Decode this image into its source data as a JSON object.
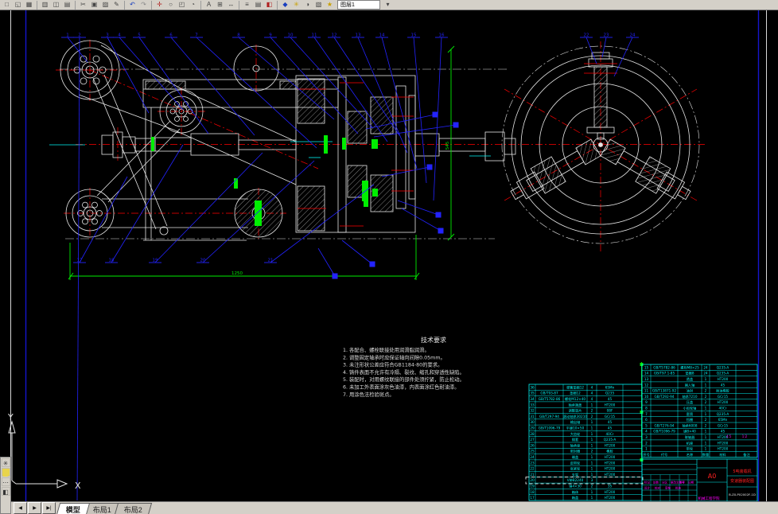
{
  "colors": {
    "canvas_bg": "#000000",
    "line_white": "#e6e6e6",
    "centerline_red": "#ff0000",
    "leader_blue": "#2323ff",
    "dim_green": "#00ee00",
    "table_cyan": "#00f5f5",
    "magenta": "#ff00ff",
    "chrome": "#d4d0c8"
  },
  "toolbar": {
    "icons": [
      {
        "name": "new-icon",
        "glyph": "□"
      },
      {
        "name": "open-icon",
        "glyph": "◱"
      },
      {
        "name": "save-icon",
        "glyph": "▦"
      },
      {
        "sep": true
      },
      {
        "name": "plot-icon",
        "glyph": "▥"
      },
      {
        "name": "plot-preview-icon",
        "glyph": "◫"
      },
      {
        "name": "publish-icon",
        "glyph": "▤"
      },
      {
        "sep": true
      },
      {
        "name": "cut-icon",
        "glyph": "✂"
      },
      {
        "name": "copy-icon",
        "glyph": "▣"
      },
      {
        "name": "paste-icon",
        "glyph": "▨"
      },
      {
        "name": "match-properties-icon",
        "glyph": "✎"
      },
      {
        "sep": true
      },
      {
        "name": "undo-icon",
        "glyph": "↶",
        "color": "#1a3fbf"
      },
      {
        "name": "redo-icon",
        "glyph": "↷",
        "color": "#8a8a8a"
      },
      {
        "sep": true
      },
      {
        "name": "pan-icon",
        "glyph": "✛",
        "color": "#b02020"
      },
      {
        "name": "zoom-realtime-icon",
        "glyph": "○"
      },
      {
        "name": "zoom-window-icon",
        "glyph": "◰"
      },
      {
        "name": "zoom-previous-icon",
        "glyph": "◔"
      },
      {
        "sep": true
      },
      {
        "name": "text-icon",
        "glyph": "A"
      },
      {
        "name": "table-icon",
        "glyph": "⊞"
      },
      {
        "name": "dimension-icon",
        "glyph": "↔"
      },
      {
        "sep": true
      },
      {
        "name": "layers-icon",
        "glyph": "≡"
      },
      {
        "name": "layer-states-icon",
        "glyph": "▤"
      },
      {
        "name": "properties-icon",
        "glyph": "◧",
        "color": "#b02020"
      },
      {
        "sep": true
      },
      {
        "name": "3d-views-icon",
        "glyph": "◆",
        "color": "#1a3fbf"
      },
      {
        "name": "light-icon",
        "glyph": "✳",
        "color": "#c8a000"
      },
      {
        "name": "render-icon",
        "glyph": "◑"
      },
      {
        "name": "sheet-set-icon",
        "glyph": "▧"
      },
      {
        "name": "star-icon",
        "glyph": "★",
        "color": "#c8a000"
      }
    ],
    "layer_combo": "图层1",
    "trailing_icons": [
      {
        "name": "layer-dropdown-arrow-icon",
        "glyph": "▾"
      }
    ]
  },
  "dock_icons": [
    {
      "name": "brightness-icon",
      "glyph": "✳"
    },
    {
      "name": "gradient-swatch-icon",
      "glyph": "▆",
      "color": "#e8d44c"
    },
    {
      "name": "more-dots-icon",
      "glyph": "⋯"
    },
    {
      "name": "half-shade-icon",
      "glyph": "◧"
    }
  ],
  "tabbar": {
    "nav": [
      "◀",
      "▶",
      "▶|"
    ],
    "tabs": [
      {
        "label": "模型",
        "active": true
      },
      {
        "label": "布局1",
        "active": false
      },
      {
        "label": "布局2",
        "active": false
      }
    ]
  },
  "ucs": {
    "x_label": "X",
    "y_label": "Y"
  },
  "tech_requirements": {
    "title": "技术要求",
    "lines": [
      "1. 各配合、螺栓联接处用润滑脂润滑。",
      "2. 调整固定轴承时应保证轴向间隙0.05mm。",
      "3. 未注形状公差应符合GB1184-80的要求。",
      "4. 铸件表面不允许有冷隔、裂纹、缩孔和穿透性缺陷。",
      "5. 装配时，对用螺纹联接的部件处须拧紧，防止松动。",
      "6. 未加工外表面涂灰色油漆，内表面涂红色耐油漆。",
      "7. 用涂色法检验斑点。"
    ]
  },
  "balloons": {
    "top": [
      "1",
      "2",
      "3",
      "4",
      "5",
      "6",
      "7",
      "8",
      "9",
      "10",
      "11",
      "12",
      "13",
      "14",
      "15",
      "16"
    ],
    "bottom": [
      "17",
      "18",
      "19",
      "20",
      "21"
    ],
    "right_view": [
      "22",
      "23",
      "24"
    ]
  },
  "dimensions": {
    "overall_width": "1250",
    "overall_height": "545"
  },
  "bom": {
    "header": [
      "序号",
      "代号",
      "名称",
      "数量",
      "材料",
      "备注"
    ],
    "left_rows": [
      [
        "36",
        "",
        "弹簧垫圈12",
        "4",
        "65Mn"
      ],
      [
        "35",
        "GB/T93-87",
        "垫圈12",
        "4",
        "Q235"
      ],
      [
        "34",
        "GB/T5782-86",
        "螺栓M12×40",
        "4",
        "45"
      ],
      [
        "33",
        "",
        "轴承端盖",
        "1",
        "HT200"
      ],
      [
        "32",
        "",
        "调整垫片",
        "2",
        "08F"
      ],
      [
        "31",
        "GB/T297-94",
        "滚动轴承30210",
        "2",
        "GCr15"
      ],
      [
        "30",
        "",
        "输出轴",
        "1",
        "45"
      ],
      [
        "29",
        "GB/T1096-79",
        "平键10×50",
        "1",
        "45"
      ],
      [
        "28",
        "",
        "大齿轮",
        "1",
        "40Cr"
      ],
      [
        "27",
        "",
        "隔套",
        "1",
        "Q235-A"
      ],
      [
        "26",
        "",
        "轴承座",
        "1",
        "HT200"
      ],
      [
        "25",
        "",
        "密封圈",
        "2",
        "橡胶"
      ],
      [
        "24",
        "",
        "端盖",
        "1",
        "HT200"
      ],
      [
        "23",
        "",
        "皮带轮",
        "1",
        "HT200"
      ],
      [
        "22",
        "",
        "张紧轮",
        "1",
        "HT200"
      ],
      [
        "21",
        "",
        "支架",
        "1",
        "HT200"
      ],
      [
        "20",
        "",
        "V带B2240",
        "3",
        ""
      ],
      [
        "19",
        "",
        "销4×30",
        "2",
        "35"
      ],
      [
        "18",
        "",
        "箱体",
        "1",
        "HT200"
      ],
      [
        "17",
        "",
        "箱盖",
        "1",
        "HT200"
      ]
    ],
    "right_rows": [
      [
        "15",
        "GB/T5782-86",
        "螺栓M8×25",
        "24",
        "Q235-A"
      ],
      [
        "14",
        "GB/T97.1-85",
        "垫圈8",
        "24",
        "Q235-A"
      ],
      [
        "13",
        "",
        "透盖",
        "1",
        "HT200"
      ],
      [
        "12",
        "",
        "输入轴",
        "1",
        "45"
      ],
      [
        "11",
        "GB/T13871-92",
        "油封",
        "2",
        "耐油橡胶"
      ],
      [
        "10",
        "GB/T292-94",
        "轴承7210",
        "2",
        "GCr15"
      ],
      [
        "9",
        "",
        "压盖",
        "2",
        "HT200"
      ],
      [
        "8",
        "",
        "小齿轮轴",
        "1",
        "40Cr"
      ],
      [
        "7",
        "",
        "套筒",
        "1",
        "Q235-A"
      ],
      [
        "6",
        "",
        "挡圈",
        "2",
        "65Mn"
      ],
      [
        "5",
        "GB/T276-94",
        "轴承6008",
        "2",
        "GCr15"
      ],
      [
        "4",
        "GB/T1096-79",
        "键8×40",
        "1",
        "45"
      ],
      [
        "3",
        "",
        "联轴器",
        "1",
        "HT200"
      ],
      [
        "2",
        "",
        "机座",
        "1",
        "HT200"
      ],
      [
        "1",
        "",
        "带轮",
        "1",
        "HT200"
      ]
    ]
  },
  "title_block": {
    "paper_size": "A0",
    "project_title": "5吨装载机",
    "drawing_title": "变速器装配图",
    "org": "机械工程学院",
    "drawing_no": "B-ZX-PX2002F-1D",
    "stamp_row1": [
      "标记",
      "处数",
      "分区",
      "更改文件号",
      "签字",
      "日期"
    ],
    "stamp_row2": [
      "设计",
      "校对",
      "审核",
      "批准"
    ],
    "extra": [
      "4.5",
      "1:2"
    ]
  }
}
